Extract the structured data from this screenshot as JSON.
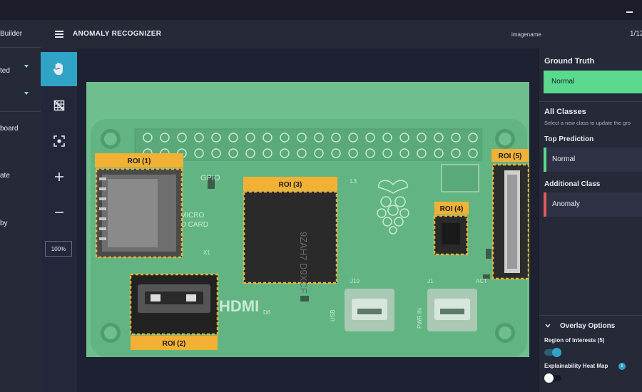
{
  "titlebar": {
    "minimize_label": "minimize"
  },
  "leftnav": {
    "title": "Builder",
    "items": [
      {
        "label": "ted",
        "has_caret": true
      },
      {
        "label": "",
        "has_caret": true
      },
      {
        "label": "board"
      },
      {
        "label": "ate"
      },
      {
        "label": "by"
      }
    ]
  },
  "header": {
    "app_title": "ANOMALY RECOGNIZER",
    "image_name": "imagename",
    "page_counter": "1/12"
  },
  "tools": {
    "items": [
      "hand-icon",
      "grid-off-icon",
      "focus-icon",
      "zoom-in-icon",
      "zoom-out-icon"
    ],
    "zoom_level": "100%"
  },
  "board": {
    "labels": {
      "gpio": "GPIO",
      "micro_sd": "MICRO\nSD CARD",
      "hdmi": "HDMI",
      "usb": "USB",
      "pwr_in": "PWR IN",
      "j10": "J10",
      "j1": "J1",
      "act": "ACT",
      "x1": "X1",
      "chip": "9ZAH7\nD9XCF",
      "l3": "L3",
      "d6": "D6"
    },
    "rois": [
      {
        "label": "ROI (1)"
      },
      {
        "label": "ROI (2)"
      },
      {
        "label": "ROI (3)"
      },
      {
        "label": "ROI (4)"
      },
      {
        "label": "ROI (5)"
      }
    ],
    "colors": {
      "overlay": "#6fbf8e",
      "roi_label": "#f2b134",
      "roi_border": "#f2b134"
    }
  },
  "rightpanel": {
    "ground_truth_heading": "Ground Truth",
    "ground_truth_value": "Normal",
    "all_classes_heading": "All Classes",
    "all_classes_hint": "Select a new class to update the gro",
    "top_prediction_heading": "Top Prediction",
    "top_prediction_value": "Normal",
    "additional_class_heading": "Additional Class",
    "additional_class_value": "Anomaly",
    "overlay_heading": "Overlay Options",
    "roi_toggle_label": "Region of Interests (5)",
    "roi_toggle_on": true,
    "heatmap_label": "Explainability Heat Map",
    "heatmap_on": false,
    "colors": {
      "normal": "#5bd98f",
      "anomaly": "#e05a5a",
      "accent": "#2fa4c6"
    }
  }
}
